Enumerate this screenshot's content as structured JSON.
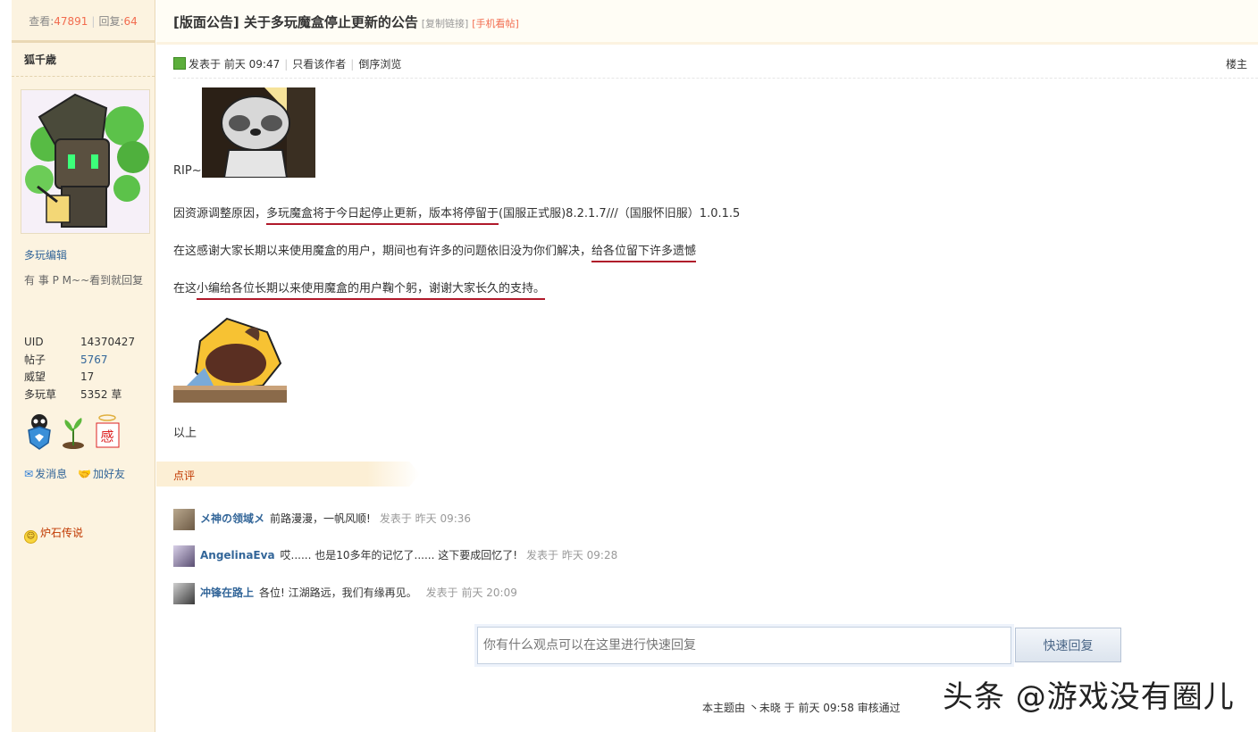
{
  "stats": {
    "views_label": "查看:",
    "views": "47891",
    "replies_label": "回复:",
    "replies": "64"
  },
  "author": {
    "name": "狐千歳",
    "group": "多玩编辑",
    "signature": "有 事 P M~~看到就回复",
    "info": [
      {
        "k": "UID",
        "v": "14370427"
      },
      {
        "k": "帖子",
        "v": "5767"
      },
      {
        "k": "威望",
        "v": "17"
      },
      {
        "k": "多玩草",
        "v": "5352 草"
      }
    ],
    "send_message": "发消息",
    "add_friend": "加好友",
    "game": "炉石传说"
  },
  "thread": {
    "title": "[版面公告] 关于多玩魔盒停止更新的公告",
    "copy_link": "[复制链接]",
    "mobile_view": "[手机看帖]"
  },
  "post": {
    "posted_at": "发表于 前天 09:47",
    "author_only": "只看该作者",
    "reverse": "倒序浏览",
    "floor": "楼主",
    "rip": "RIP~",
    "p1_a": "因资源调整原因，",
    "p1_u": "多玩魔盒将于今日起停止更新，版本将停留于",
    "p1_b": "(国服正式服)8.2.1.7///（国服怀旧服）1.0.1.5",
    "p2_a": "在这感谢大家长期以来使用魔盒的用户，期间也有许多的问题依旧没为你们解决，",
    "p2_u": "给各位留下许多遗憾",
    "p3_a": "在这",
    "p3_u": "小编给各位长期以来使用魔盒的用户鞠个躬，谢谢大家长久的支持。",
    "end": "以上"
  },
  "comments": {
    "header": "点评",
    "items": [
      {
        "name": "メ神の领域メ",
        "text": "前路漫漫，一帆风顺!",
        "time": "发表于 昨天 09:36"
      },
      {
        "name": "AngelinaEva",
        "text": "哎...... 也是10多年的记忆了...... 这下要成回忆了!",
        "time": "发表于 昨天 09:28"
      },
      {
        "name": "冲锋在路上",
        "text": "各位! 江湖路远，我们有缘再见。",
        "time": "发表于 前天 20:09"
      }
    ]
  },
  "reply": {
    "placeholder": "你有什么观点可以在这里进行快速回复",
    "button": "快速回复"
  },
  "audit": "本主题由 丶未晓 于 前天 09:58 审核通过",
  "watermark": "头条 @游戏没有圈儿"
}
